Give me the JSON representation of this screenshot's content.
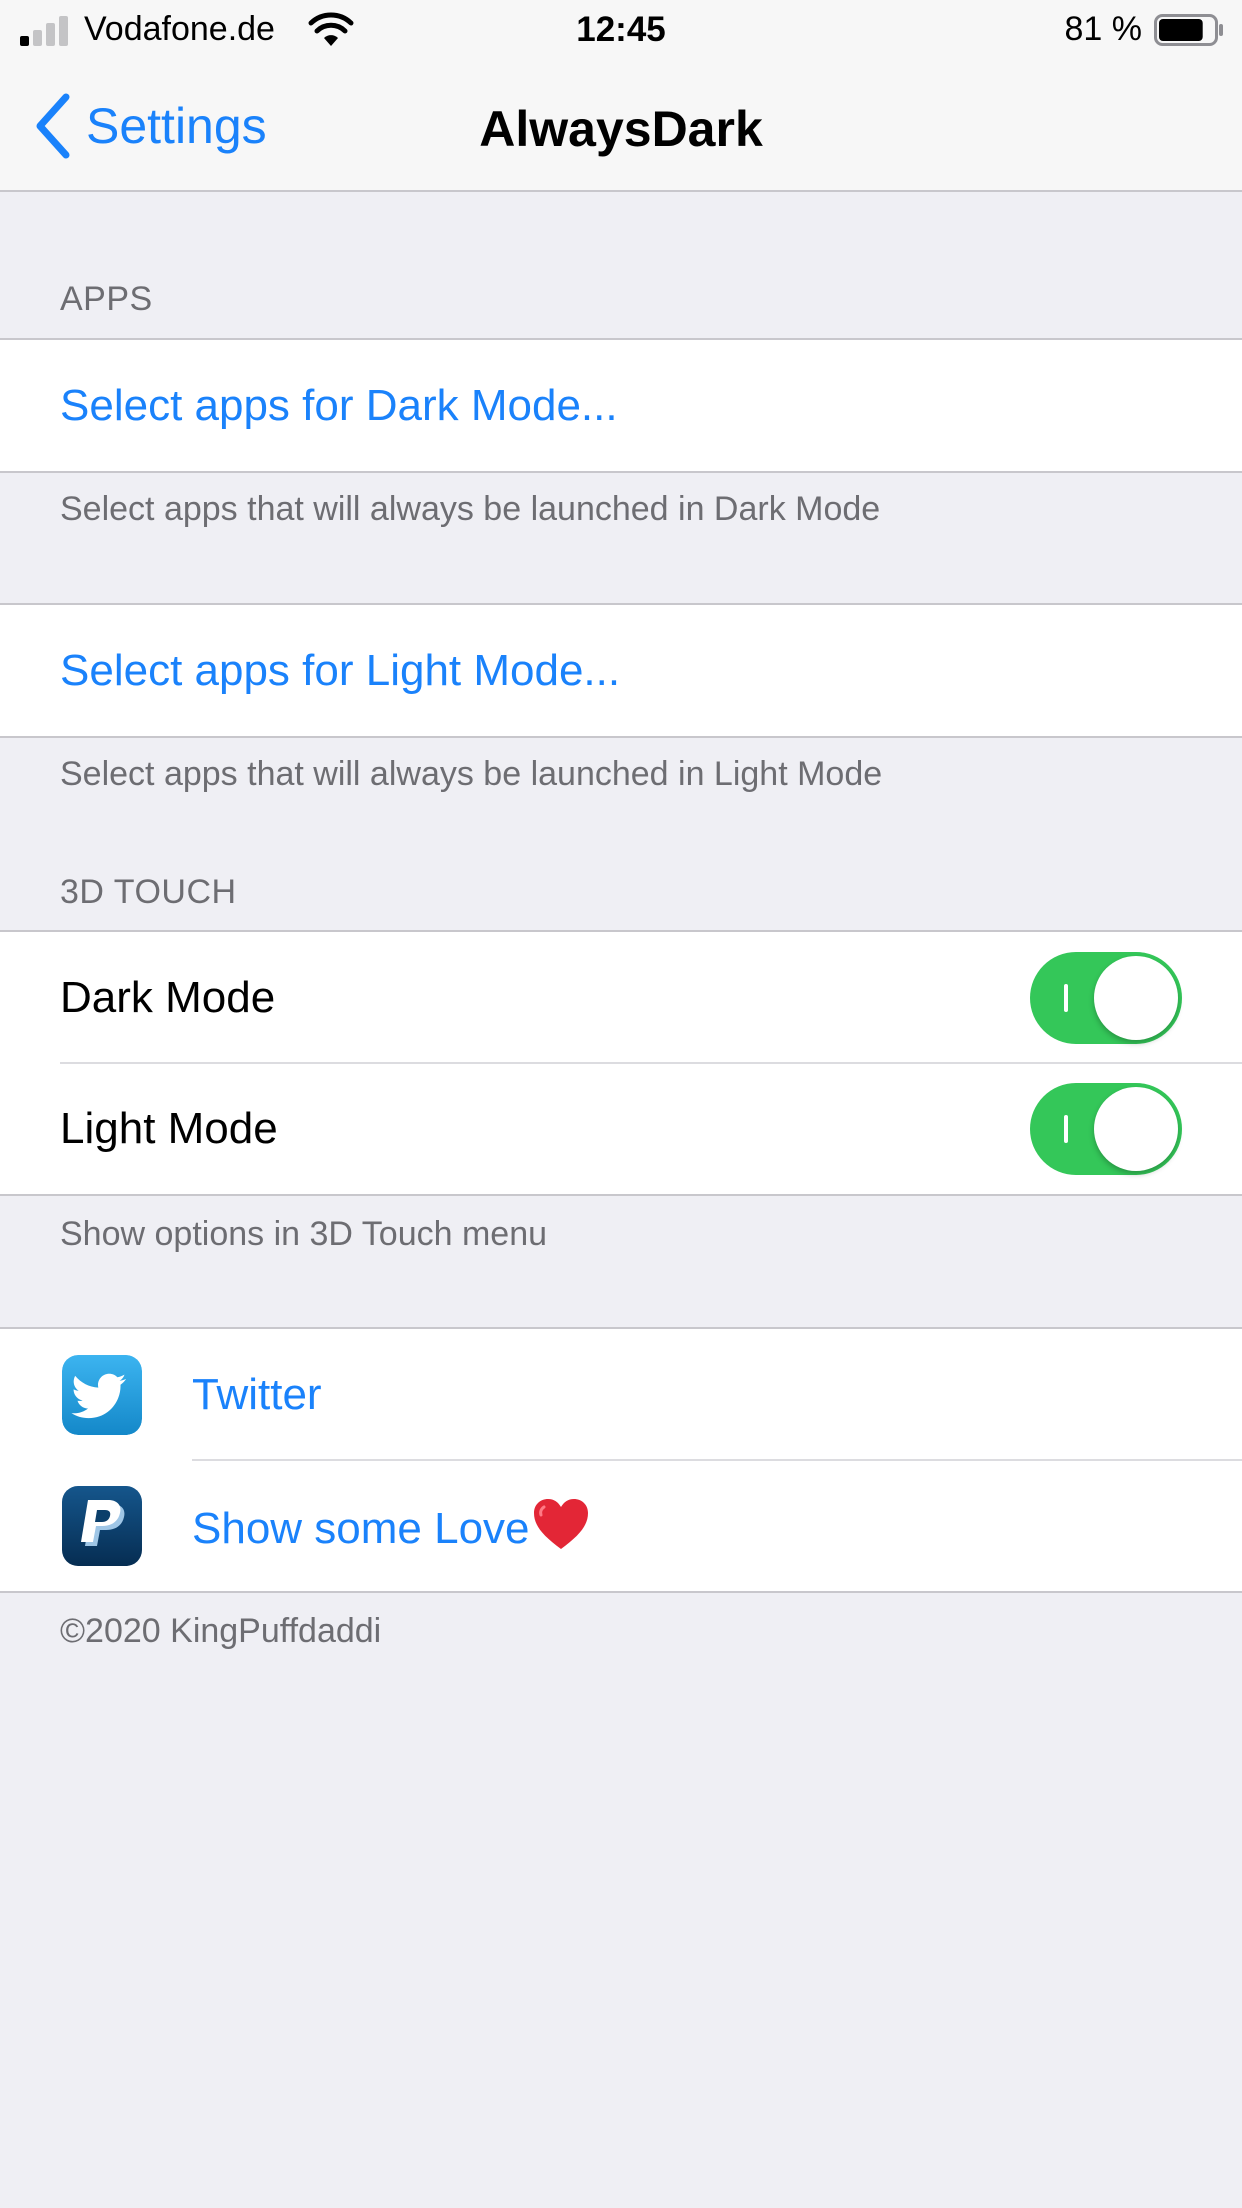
{
  "status_bar": {
    "carrier": "Vodafone.de",
    "time": "12:45",
    "battery_percent": "81 %",
    "battery_level": 0.81,
    "signal_bars_active": 1,
    "signal_bars_total": 4
  },
  "nav": {
    "back_label": "Settings",
    "title": "AlwaysDark"
  },
  "sections": {
    "apps": {
      "header": "APPS",
      "dark_link": "Select apps for Dark Mode...",
      "dark_note": "Select apps that will always be launched in Dark Mode",
      "light_link": "Select apps for Light Mode...",
      "light_note": "Select apps that will always be launched in Light Mode"
    },
    "touch": {
      "header": "3D TOUCH",
      "dark_label": "Dark Mode",
      "dark_on": true,
      "light_label": "Light Mode",
      "light_on": true,
      "note": "Show options in 3D Touch menu"
    },
    "links": {
      "twitter_label": "Twitter",
      "love_label": "Show some Love"
    },
    "copyright": "©2020 KingPuffdaddi"
  },
  "colors": {
    "accent": "#1a82fb",
    "switch_on": "#34c759",
    "background": "#efeff4",
    "twitter": "#1da1f2",
    "paypal": "#0b3f6a"
  },
  "icons": {
    "twitter": "twitter-bird-icon",
    "paypal": "paypal-icon",
    "heart": "red-heart-icon"
  }
}
